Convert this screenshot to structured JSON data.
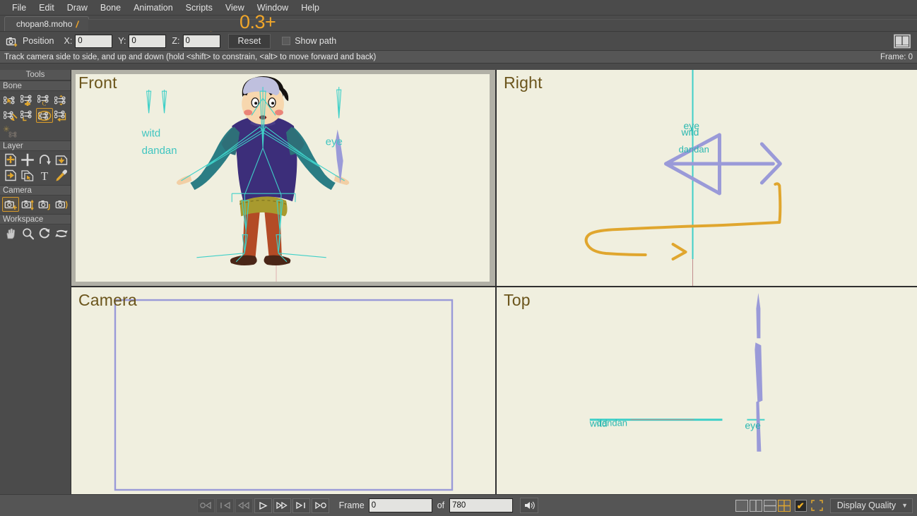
{
  "app": {
    "name": "Moho",
    "menu": [
      "File",
      "Edit",
      "Draw",
      "Bone",
      "Animation",
      "Scripts",
      "View",
      "Window",
      "Help"
    ]
  },
  "tab": {
    "document": "chopan8.moho",
    "dirty_marker": "/",
    "annotation": "0.3+"
  },
  "options_bar": {
    "tool_icon": "camera-track-icon",
    "title": "Position",
    "x_label": "X:",
    "x_value": "0",
    "y_label": "Y:",
    "y_value": "0",
    "z_label": "Z:",
    "z_value": "0",
    "reset_label": "Reset",
    "show_path_label": "Show path",
    "show_path_checked": false,
    "help_icon": "book-icon"
  },
  "hint_bar": {
    "text": "Track camera side to side, and up and down (hold <shift> to constrain, <alt> to move forward and back)",
    "frame_indicator": "Frame: 0"
  },
  "toolbox": {
    "header": "Tools",
    "sections": [
      {
        "title": "Bone",
        "tools": [
          {
            "name": "select-bone-icon",
            "selected": false
          },
          {
            "name": "add-bone-icon",
            "selected": false
          },
          {
            "name": "reparent-bone-icon",
            "selected": false
          },
          {
            "name": "bone-strength-icon",
            "selected": false
          },
          {
            "name": "manipulate-bones-icon",
            "selected": false
          },
          {
            "name": "offset-bone-icon",
            "selected": false
          },
          {
            "name": "transform-bone-icon",
            "selected": false
          },
          {
            "name": "bind-layer-icon",
            "selected": false
          },
          {
            "name": "bind-points-icon",
            "selected": false
          }
        ]
      },
      {
        "title": "Layer",
        "tools": [
          {
            "name": "translate-layer-icon",
            "selected": false
          },
          {
            "name": "scale-layer-icon",
            "selected": false
          },
          {
            "name": "rotate-layer-z-icon",
            "selected": false
          },
          {
            "name": "shear-layer-icon",
            "selected": false
          },
          {
            "name": "flip-layer-icon",
            "selected": false
          },
          {
            "name": "set-origin-icon",
            "selected": false
          },
          {
            "name": "text-tool-icon",
            "selected": false
          },
          {
            "name": "eyedropper-icon",
            "selected": false
          }
        ]
      },
      {
        "title": "Camera",
        "tools": [
          {
            "name": "track-camera-icon",
            "selected": true
          },
          {
            "name": "zoom-camera-icon",
            "selected": false
          },
          {
            "name": "roll-camera-icon",
            "selected": false
          },
          {
            "name": "pan-tilt-camera-icon",
            "selected": false
          }
        ]
      },
      {
        "title": "Workspace",
        "tools": [
          {
            "name": "pan-workspace-icon",
            "selected": false
          },
          {
            "name": "zoom-workspace-icon",
            "selected": false
          },
          {
            "name": "rotate-workspace-icon",
            "selected": false
          },
          {
            "name": "orbit-workspace-icon",
            "selected": false
          }
        ]
      }
    ]
  },
  "viewports": [
    {
      "id": "front",
      "title": "Front",
      "active": true
    },
    {
      "id": "right",
      "title": "Right",
      "active": false
    },
    {
      "id": "camera",
      "title": "Camera",
      "active": false
    },
    {
      "id": "top",
      "title": "Top",
      "active": false
    }
  ],
  "bone_labels": {
    "witd": "witd",
    "dandan": "dandan",
    "eye": "eye"
  },
  "timeline": {
    "transport": [
      {
        "name": "rewind-to-start-button",
        "glyph": "○◁",
        "enabled": false
      },
      {
        "name": "previous-keyframe-button",
        "glyph": "|◁",
        "enabled": false
      },
      {
        "name": "step-back-button",
        "glyph": "◁◁",
        "enabled": false
      },
      {
        "name": "play-button",
        "glyph": "▷",
        "enabled": true
      },
      {
        "name": "fast-forward-button",
        "glyph": "▷▷",
        "enabled": true
      },
      {
        "name": "next-keyframe-button",
        "glyph": "▷|",
        "enabled": true
      },
      {
        "name": "go-to-end-button",
        "glyph": "▷○",
        "enabled": true
      }
    ],
    "frame_label": "Frame",
    "frame_value": "0",
    "of_label": "of",
    "total_frames": "780",
    "audio_icon": "speaker-icon"
  },
  "layout_bar": {
    "buttons": [
      {
        "name": "layout-single-view-button",
        "active": false
      },
      {
        "name": "layout-two-columns-button",
        "active": false
      },
      {
        "name": "layout-two-rows-button",
        "active": false
      },
      {
        "name": "layout-quad-view-button",
        "active": true
      }
    ],
    "checkbox": {
      "name": "enable-overlay-checkbox",
      "checked": true,
      "glyph": "✔"
    },
    "crop_icon": "crop-marks-icon",
    "display_quality_label": "Display Quality",
    "display_quality_caret": "▼"
  },
  "colors": {
    "chrome": "#4b4b4b",
    "chrome_light": "#555555",
    "paper": "#f0efdf",
    "accent_orange": "#e0a62e",
    "title_brown": "#6b551c",
    "bone_cyan": "#3fd0c8",
    "bone_purple": "#9a9ad8",
    "annotation_orange": "#f0a62a"
  }
}
